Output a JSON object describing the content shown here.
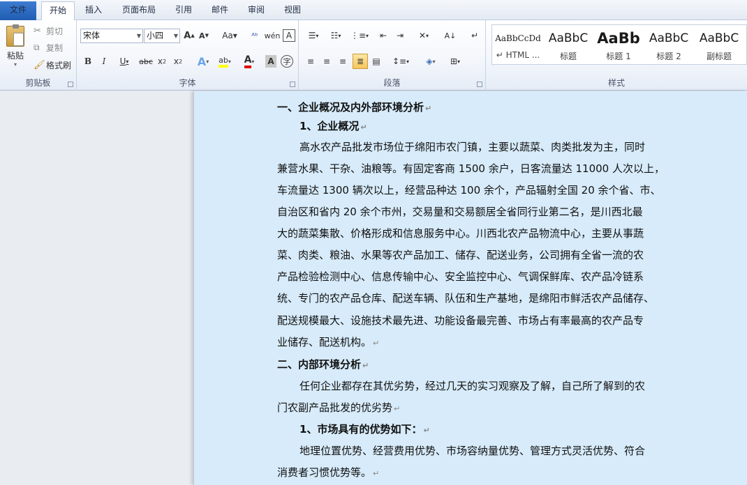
{
  "tabs": {
    "file": "文件",
    "home": "开始",
    "insert": "插入",
    "layout": "页面布局",
    "references": "引用",
    "mailings": "邮件",
    "review": "审阅",
    "view": "视图"
  },
  "clipboard": {
    "paste": "粘贴",
    "cut": "剪切",
    "copy": "复制",
    "format_painter": "格式刷",
    "label": "剪贴板"
  },
  "font": {
    "name": "宋体",
    "size": "小四",
    "label": "字体"
  },
  "paragraph": {
    "label": "段落"
  },
  "styles": {
    "label": "样式",
    "items": [
      {
        "sample": "AaBbCcDd",
        "name": "HTML ..."
      },
      {
        "sample": "AaBbC",
        "name": "标题"
      },
      {
        "sample": "AaBb",
        "name": "标题 1"
      },
      {
        "sample": "AaBbC",
        "name": "标题 2"
      },
      {
        "sample": "AaBbC",
        "name": "副标题"
      }
    ]
  },
  "document": {
    "lines": [
      "一、企业概况及内外部环境分析",
      "1、企业概况",
      "高水农产品批发市场位于绵阳市农门镇，主要以蔬菜、肉类批发为主，同时",
      "兼营水果、干杂、油粮等。有固定客商 1500 余户，日客流量达 11000 人次以上，",
      "车流量达 1300 辆次以上，经营品种达 100 余个，产品辐射全国 20 余个省、市、",
      "自治区和省内 20 余个市州，交易量和交易额居全省同行业第二名，是川西北最",
      "大的蔬菜集散、价格形成和信息服务中心。川西北农产品物流中心，主要从事蔬",
      "菜、肉类、粮油、水果等农产品加工、储存、配送业务，公司拥有全省一流的农",
      "产品检验检测中心、信息传输中心、安全监控中心、气调保鲜库、农产品冷链系",
      "统、专门的农产品仓库、配送车辆、队伍和生产基地，是绵阳市鲜活农产品储存、",
      "配送规模最大、设施技术最先进、功能设备最完善、市场占有率最高的农产品专",
      "业储存、配送机构。",
      "二、内部环境分析",
      "任何企业都存在其优劣势，经过几天的实习观察及了解，自己所了解到的农",
      "门农副产品批发的优劣势",
      "1、市场具有的优势如下：",
      "地理位置优势、经营费用优势、市场容纳量优势、管理方式灵活优势、符合",
      "消费者习惯优势等。"
    ]
  }
}
